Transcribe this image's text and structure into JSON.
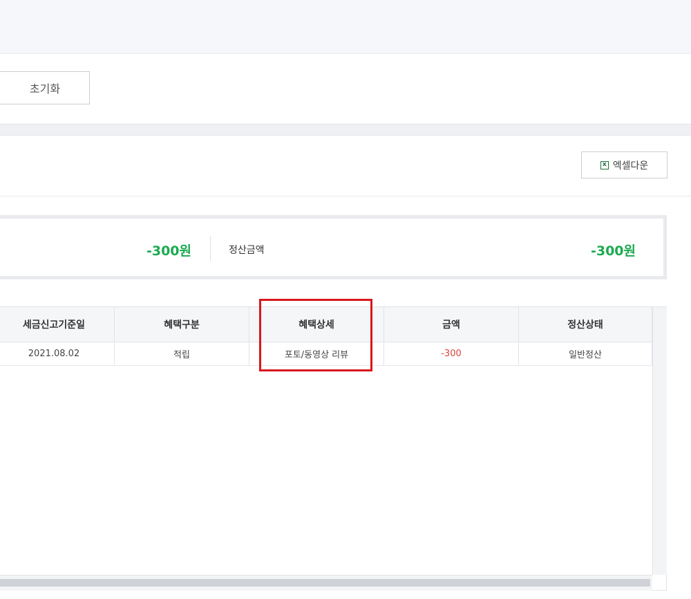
{
  "filter": {
    "reset_label": "초기화"
  },
  "toolbar": {
    "excel_label": "엑셀다운",
    "excel_icon": "x"
  },
  "summary": {
    "left_amount": "-300원",
    "settlement_label": "정산금액",
    "settlement_amount": "-300원",
    "amount_color": "#1aaa4f"
  },
  "grid": {
    "headers": [
      "세금신고기준일",
      "혜택구분",
      "혜택상세",
      "금액",
      "정산상태"
    ],
    "rows": [
      [
        "2021.08.02",
        "적립",
        "포토/동영상 리뷰",
        "-300",
        "일반정산"
      ]
    ]
  }
}
